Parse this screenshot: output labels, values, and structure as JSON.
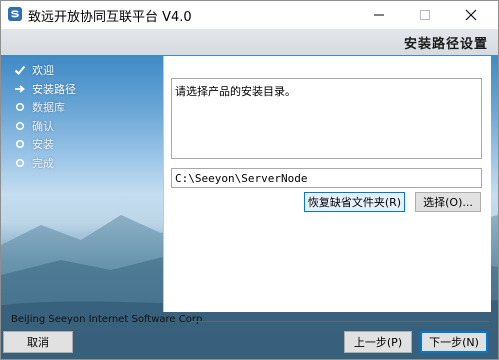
{
  "window": {
    "title": "致远开放协同互联平台 V4.0",
    "minimize_glyph": "—",
    "maximize_glyph": "□",
    "close_glyph": "✕"
  },
  "header": {
    "title": "安装路径设置"
  },
  "steps": [
    {
      "label": "欢迎",
      "state": "done",
      "icon": "check-icon"
    },
    {
      "label": "安装路径",
      "state": "current",
      "icon": "arrow-right-icon"
    },
    {
      "label": "数据库",
      "state": "pending",
      "icon": "circle-icon"
    },
    {
      "label": "确认",
      "state": "pending",
      "icon": "circle-icon"
    },
    {
      "label": "安装",
      "state": "pending",
      "icon": "circle-icon"
    },
    {
      "label": "完成",
      "state": "pending",
      "icon": "circle-icon"
    }
  ],
  "content": {
    "description": "请选择产品的安装目录。",
    "path_value": "C:\\Seeyon\\ServerNode",
    "restore_button": "恢复缺省文件夹(R)",
    "choose_button": "选择(O)..."
  },
  "footer": {
    "company": "BeiJing Seeyon Internet Software Corp.",
    "cancel_button": "取消",
    "prev_button": "上一步(P)",
    "next_button": "下一步(N)"
  },
  "colors": {
    "accent": "#0078d7",
    "header_band": "#dde0e4",
    "app_icon": "#2f6fb5"
  }
}
